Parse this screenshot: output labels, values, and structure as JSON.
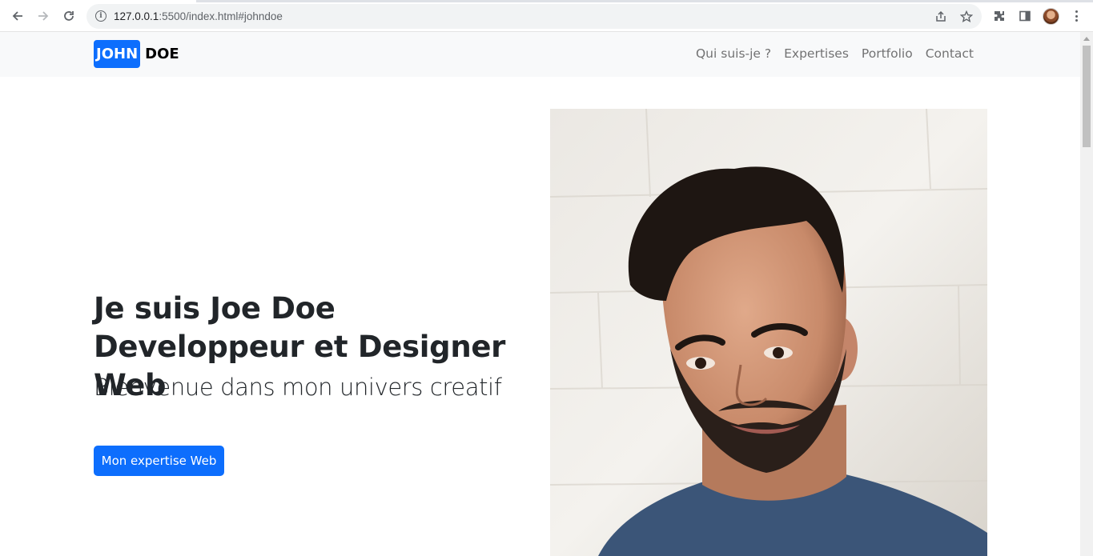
{
  "browser": {
    "url_host": "127.0.0.1",
    "url_path": ":5500/index.html#johndoe"
  },
  "site": {
    "brand_first": "JOHN",
    "brand_last": "DOE",
    "nav": [
      {
        "label": "Qui suis-je ?"
      },
      {
        "label": "Expertises"
      },
      {
        "label": "Portfolio"
      },
      {
        "label": "Contact"
      }
    ]
  },
  "hero": {
    "title": "Je suis Joe Doe Developpeur et Designer Web",
    "subtitle": "Bienvenue dans mon univers creatif",
    "cta_label": "Mon expertise Web"
  },
  "colors": {
    "accent": "#0d6efd",
    "navbar_bg": "#f8f9fa"
  }
}
